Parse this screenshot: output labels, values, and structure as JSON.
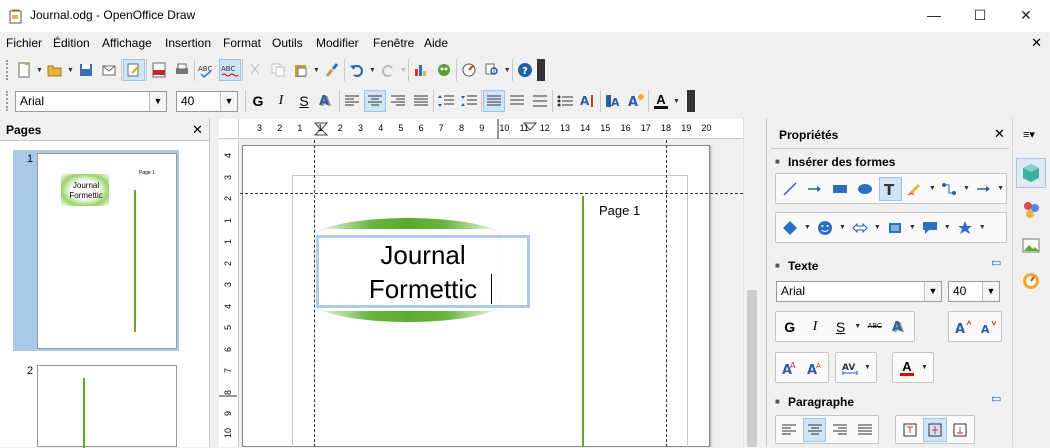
{
  "window": {
    "title": "Journal.odg - OpenOffice Draw",
    "minimize": "—",
    "maximize": "☐",
    "close": "✕"
  },
  "menu": [
    "Fichier",
    "Édition",
    "Affichage",
    "Insertion",
    "Format",
    "Outils",
    "Modifier",
    "Fenêtre",
    "Aide"
  ],
  "doc_close": "✕",
  "format_bar": {
    "font_name": "Arial",
    "font_size": "40",
    "bold": "G",
    "italic": "I",
    "underline": "S",
    "font_color_label": "A"
  },
  "pages_panel": {
    "title": "Pages",
    "close": "✕",
    "pages": [
      {
        "number": "1",
        "thumb_title": "Journal Formettic",
        "thumb_header": "Page 1"
      },
      {
        "number": "2"
      }
    ]
  },
  "hruler": {
    "labels": [
      "3",
      "2",
      "1",
      "1",
      "2",
      "3",
      "4",
      "5",
      "6",
      "7",
      "8",
      "9",
      "10",
      "11",
      "12",
      "13",
      "14",
      "15",
      "16",
      "17",
      "18",
      "19",
      "20"
    ]
  },
  "vruler": {
    "labels": [
      "4",
      "3",
      "2",
      "1",
      "1",
      "2",
      "3",
      "4",
      "5",
      "6",
      "7",
      "8",
      "9",
      "10"
    ]
  },
  "document": {
    "title_line1": "Journal",
    "title_line2": "Formettic",
    "header": "Page 1"
  },
  "sidebar": {
    "title": "Propriétés",
    "close": "✕",
    "sections": {
      "shapes": {
        "title": "Insérer des formes"
      },
      "text": {
        "title": "Texte",
        "font_name": "Arial",
        "font_size": "40",
        "bold": "G",
        "italic": "I",
        "underline": "S",
        "strike": "ABC",
        "font_color": "A"
      },
      "paragraph": {
        "title": "Paragraphe"
      }
    }
  },
  "colors": {
    "accent_green": "#5aac2c",
    "selection_blue": "#aac8e8",
    "font_color_red": "#e00000"
  }
}
